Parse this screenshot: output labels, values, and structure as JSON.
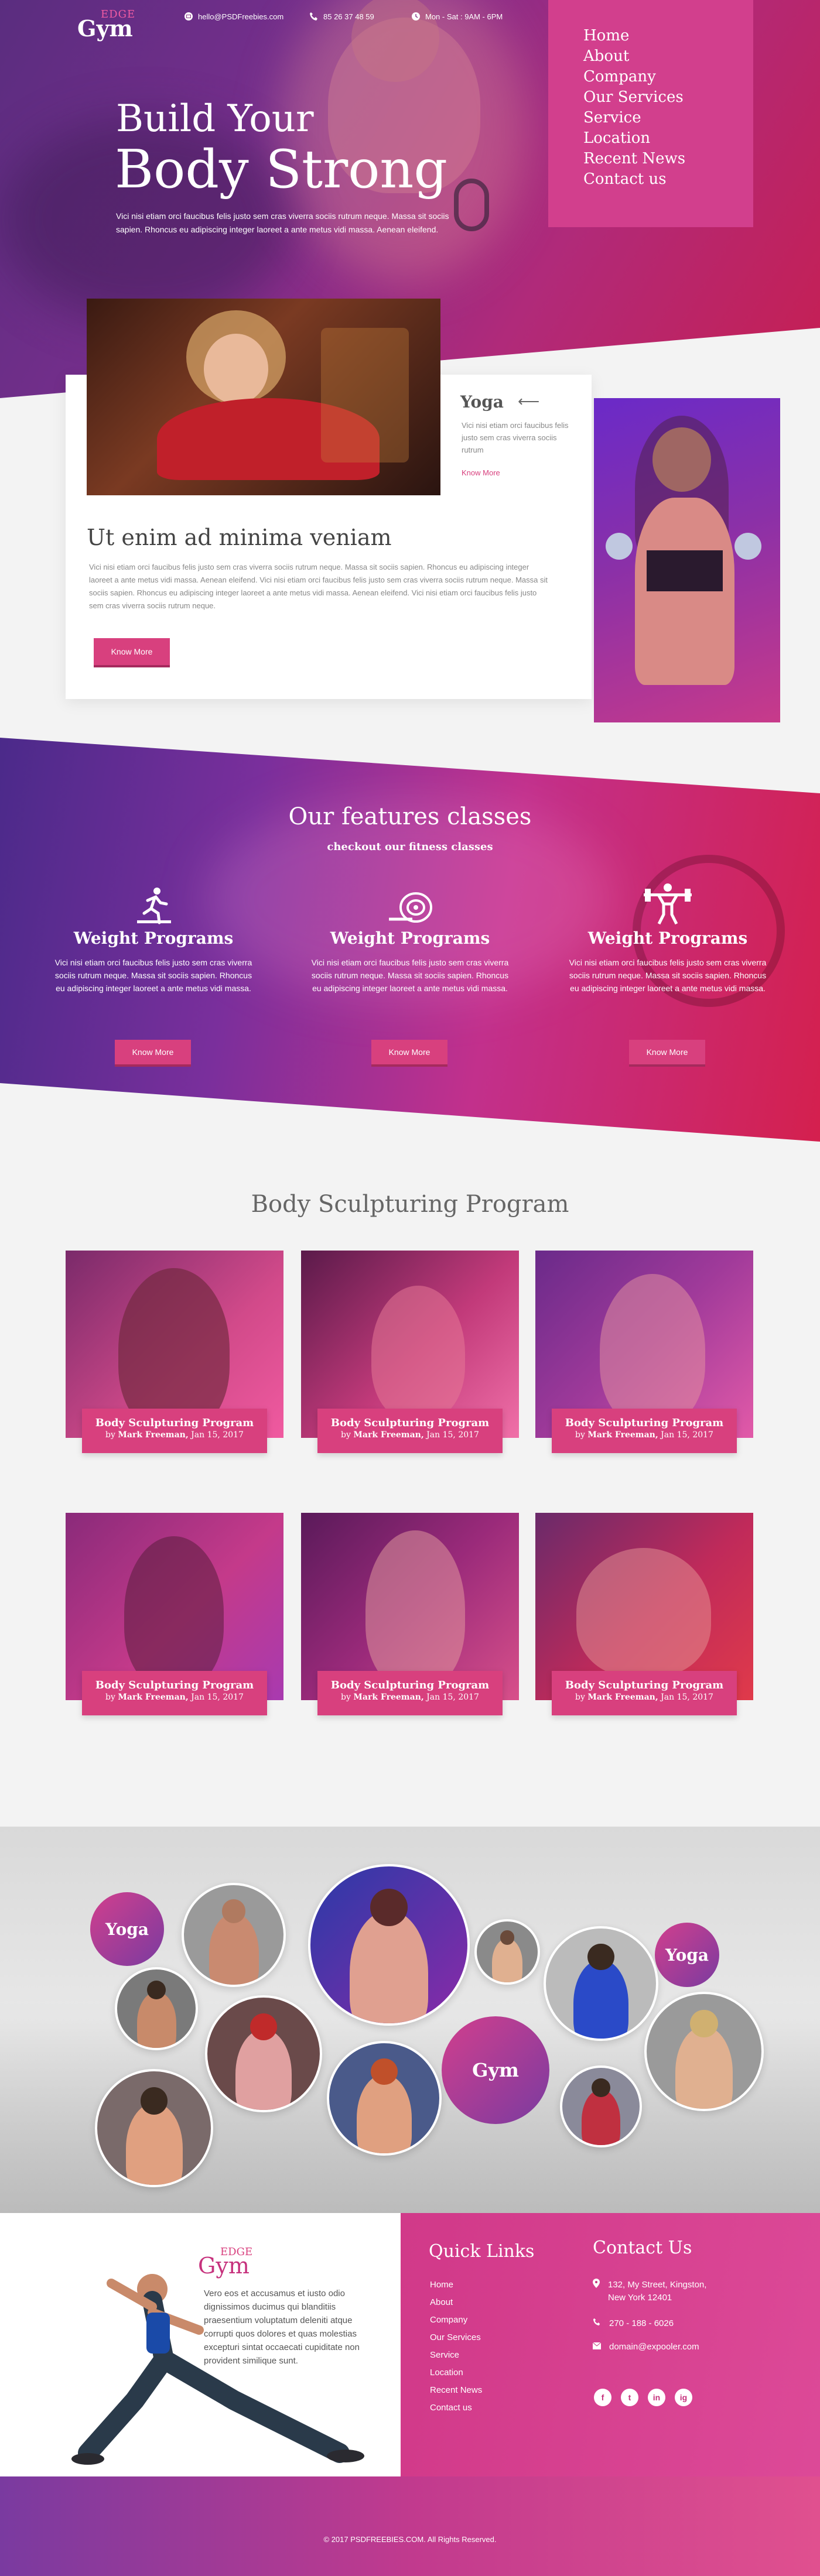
{
  "brand": {
    "small": "EDGE",
    "name": "Gym"
  },
  "topbar": {
    "email": "hello@PSDFreebies.com",
    "phone": "85 26 37 48 59",
    "hours": "Mon - Sat : 9AM - 6PM"
  },
  "nav": {
    "items": [
      "Home",
      "About",
      "Company",
      "Our Services",
      "Service",
      "Location",
      "Recent News",
      "Contact us"
    ]
  },
  "hero": {
    "title_line1": "Build Your",
    "title_line2": "Body Strong",
    "text": "Vici nisi etiam orci faucibus felis justo sem cras viverra sociis rutrum neque. Massa sit sociis sapien. Rhoncus eu adipiscing integer laoreet a ante metus vidi massa. Aenean eleifend."
  },
  "yoga_card": {
    "title": "Yoga",
    "arrow": "⟵",
    "text": "Vici nisi etiam orci faucibus felis justo sem cras viverra sociis rutrum",
    "link": "Know More"
  },
  "intro": {
    "title": "Ut enim ad minima veniam",
    "text": "Vici nisi etiam orci faucibus felis justo sem cras viverra sociis rutrum neque. Massa sit sociis sapien. Rhoncus eu adipiscing integer laoreet a ante metus vidi massa. Aenean eleifend. Vici nisi etiam orci faucibus felis justo sem cras viverra sociis rutrum neque. Massa sit sociis sapien. Rhoncus eu adipiscing integer laoreet a ante metus vidi massa. Aenean eleifend. Vici nisi etiam orci faucibus felis justo sem cras viverra sociis rutrum neque.",
    "button": "Know More"
  },
  "features": {
    "title": "Our features classes",
    "subtitle": "checkout our fitness classes",
    "items": [
      {
        "icon": "running-icon",
        "title": "Weight Programs",
        "text": "Vici nisi etiam orci faucibus felis justo sem cras viverra sociis rutrum neque. Massa sit sociis sapien. Rhoncus eu adipiscing integer laoreet a ante metus vidi massa.",
        "button": "Know More"
      },
      {
        "icon": "yoga-mat-icon",
        "title": "Weight Programs",
        "text": "Vici nisi etiam orci faucibus felis justo sem cras viverra sociis rutrum neque. Massa sit sociis sapien. Rhoncus eu adipiscing integer laoreet a ante metus vidi massa.",
        "button": "Know More"
      },
      {
        "icon": "weightlifting-icon",
        "title": "Weight Programs",
        "text": "Vici nisi etiam orci faucibus felis justo sem cras viverra sociis rutrum neque. Massa sit sociis sapien. Rhoncus eu adipiscing integer laoreet a ante metus vidi massa.",
        "button": "Know More"
      }
    ]
  },
  "sculpt": {
    "title": "Body Sculpturing Program",
    "items": [
      {
        "title": "Body Sculpturing Program",
        "by": "by",
        "author": "Mark Freeman,",
        "date": "Jan 15, 2017"
      },
      {
        "title": "Body Sculpturing Program",
        "by": "by",
        "author": "Mark Freeman,",
        "date": "Jan 15, 2017"
      },
      {
        "title": "Body Sculpturing Program",
        "by": "by",
        "author": "Mark Freeman,",
        "date": "Jan 15, 2017"
      },
      {
        "title": "Body Sculpturing Program",
        "by": "by",
        "author": "Mark Freeman,",
        "date": "Jan 15, 2017"
      },
      {
        "title": "Body Sculpturing Program",
        "by": "by",
        "author": "Mark Freeman,",
        "date": "Jan 15, 2017"
      },
      {
        "title": "Body Sculpturing Program",
        "by": "by",
        "author": "Mark Freeman,",
        "date": "Jan 15, 2017"
      }
    ]
  },
  "gallery": {
    "labels": [
      "Yoga",
      "Yoga",
      "Gym"
    ]
  },
  "footer": {
    "about": "Vero eos et accusamus et iusto odio dignissimos ducimus qui blanditiis praesentium voluptatum deleniti atque corrupti quos dolores et quas molestias excepturi sintat occaecati cupiditate non provident similique sunt.",
    "quick_title": "Quick Links",
    "quick_links": [
      "Home",
      "About",
      "Company",
      "Our Services",
      "Service",
      "Location",
      "Recent News",
      "Contact us"
    ],
    "contact_title": "Contact Us",
    "address": "132, My Street, Kingston, New York 12401",
    "phone": "270 - 188 - 6026",
    "email": "domain@expooler.com",
    "social": [
      "f",
      "t",
      "in",
      "ig"
    ],
    "copyright": "© 2017 PSDFREEBIES.COM. All Rights Reserved."
  },
  "colors": {
    "accent": "#d8407e",
    "menu_bg": "#d23f8d",
    "purple": "#7a3ba0"
  }
}
